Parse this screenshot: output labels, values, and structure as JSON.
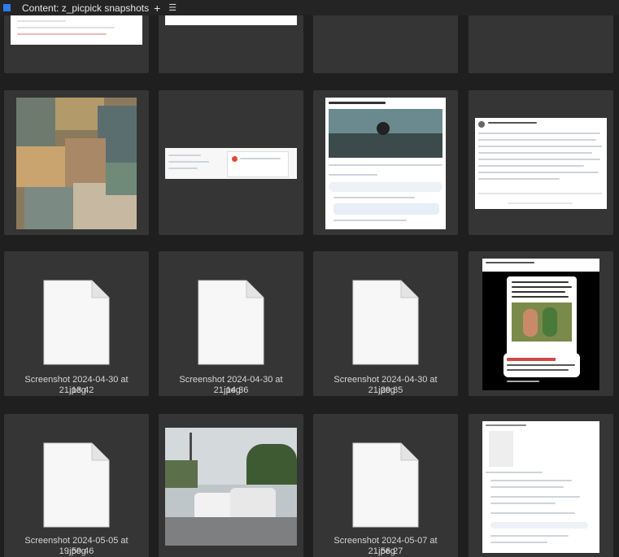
{
  "window": {
    "title": "Content: z_picpick snapshots",
    "add_icon": "plus-icon",
    "menu_icon": "menu-icon"
  },
  "files": [
    {
      "name_line1": "",
      "name_line2": ""
    },
    {
      "name_line1": "",
      "name_line2": ""
    },
    {
      "name_line1": "",
      "name_line2": ""
    },
    {
      "name_line1": "",
      "name_line2": ""
    },
    {
      "name_line1": "",
      "name_line2": ""
    },
    {
      "name_line1": "",
      "name_line2": ""
    },
    {
      "name_line1": "",
      "name_line2": ""
    },
    {
      "name_line1": "",
      "name_line2": ""
    },
    {
      "name_line1": "Screenshot 2024-04-30 at 21.13.42",
      "name_line2": ".jpeg"
    },
    {
      "name_line1": "Screenshot 2024-04-30 at 21.14.36",
      "name_line2": ".jpeg"
    },
    {
      "name_line1": "Screenshot 2024-04-30 at 21.29.35",
      "name_line2": ".jpeg"
    },
    {
      "name_line1": "",
      "name_line2": ""
    },
    {
      "name_line1": "Screenshot 2024-05-05 at 19.59.46",
      "name_line2": ".jpeg"
    },
    {
      "name_line1": "",
      "name_line2": ""
    },
    {
      "name_line1": "Screenshot 2024-05-07 at 21.56.27",
      "name_line2": ".jpeg"
    },
    {
      "name_line1": "",
      "name_line2": ""
    }
  ],
  "thumb_text": {
    "post_group": "Civil Eats Owners New Zealand",
    "quote_image": "I had so much fun during my trip. I stayed in a local village! The village of West has such a beautiful ethnic culture. Never get to connect with the diverse tribe. Lucky boy",
    "reply_text": "Yeah, it's true that white people see the diversity. Fun to see we actually are the diversity"
  }
}
